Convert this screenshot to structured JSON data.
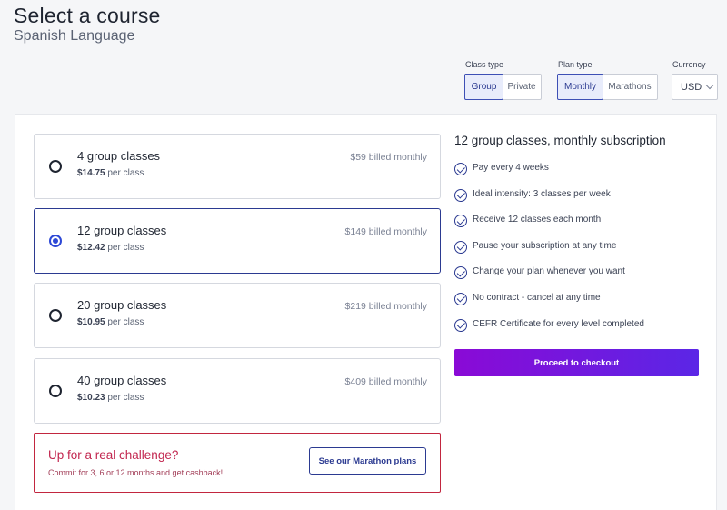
{
  "header": {
    "title": "Select a course",
    "subtitle": "Spanish Language"
  },
  "filters": {
    "class_type": {
      "label": "Class type",
      "options": [
        "Group",
        "Private"
      ],
      "selected": "Group"
    },
    "plan_type": {
      "label": "Plan type",
      "options": [
        "Monthly",
        "Marathons"
      ],
      "selected": "Monthly"
    },
    "currency": {
      "label": "Currency",
      "value": "USD"
    }
  },
  "plans": [
    {
      "name": "4 group classes",
      "price": "$14.75",
      "per": "per class",
      "billing": "$59 billed monthly",
      "selected": false
    },
    {
      "name": "12 group classes",
      "price": "$12.42",
      "per": "per class",
      "billing": "$149 billed monthly",
      "selected": true
    },
    {
      "name": "20 group classes",
      "price": "$10.95",
      "per": "per class",
      "billing": "$219 billed monthly",
      "selected": false
    },
    {
      "name": "40 group classes",
      "price": "$10.23",
      "per": "per class",
      "billing": "$409 billed monthly",
      "selected": false
    }
  ],
  "challenge": {
    "title": "Up for a real challenge?",
    "subtitle": "Commit for 3, 6 or 12 months and get cashback!",
    "button_label": "See our Marathon plans"
  },
  "summary": {
    "title": "12 group classes, monthly subscription",
    "benefits": [
      "Pay every 4 weeks",
      "Ideal intensity: 3 classes per week",
      "Receive 12 classes each month",
      "Pause your subscription at any time",
      "Change your plan whenever you want",
      "No contract - cancel at any time",
      "CEFR Certificate for every level completed"
    ],
    "checkout_label": "Proceed to checkout"
  },
  "colors": {
    "accent": "#2b3a91",
    "radio_selected": "#2d48d6",
    "challenge": "#c2264f",
    "checkout_start": "#8a0ad6",
    "checkout_end": "#5b26e6"
  }
}
